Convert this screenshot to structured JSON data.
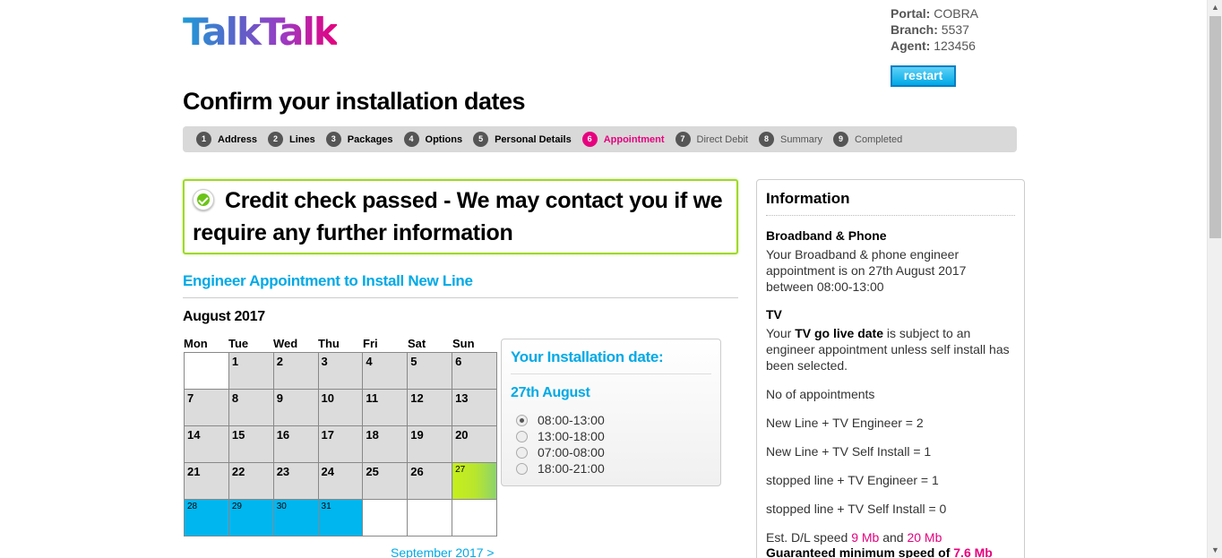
{
  "logo": {
    "text": "TalkTalk"
  },
  "portal": {
    "portal_label": "Portal:",
    "portal_value": "COBRA",
    "branch_label": "Branch:",
    "branch_value": "5537",
    "agent_label": "Agent:",
    "agent_value": "123456",
    "restart_label": "restart"
  },
  "page_title": "Confirm your installation dates",
  "steps": [
    {
      "num": "1",
      "label": "Address"
    },
    {
      "num": "2",
      "label": "Lines"
    },
    {
      "num": "3",
      "label": "Packages"
    },
    {
      "num": "4",
      "label": "Options"
    },
    {
      "num": "5",
      "label": "Personal Details"
    },
    {
      "num": "6",
      "label": "Appointment"
    },
    {
      "num": "7",
      "label": "Direct Debit"
    },
    {
      "num": "8",
      "label": "Summary"
    },
    {
      "num": "9",
      "label": "Completed"
    }
  ],
  "credit_message": "Credit check passed - We may contact you if we require any further information",
  "engineer_heading": "Engineer Appointment to Install New Line",
  "calendar": {
    "month": "August 2017",
    "days_of_week": [
      "Mon",
      "Tue",
      "Wed",
      "Thu",
      "Fri",
      "Sat",
      "Sun"
    ],
    "weeks": [
      [
        "",
        "1",
        "2",
        "3",
        "4",
        "5",
        "6"
      ],
      [
        "7",
        "8",
        "9",
        "10",
        "11",
        "12",
        "13"
      ],
      [
        "14",
        "15",
        "16",
        "17",
        "18",
        "19",
        "20"
      ],
      [
        "21",
        "22",
        "23",
        "24",
        "25",
        "26",
        "27"
      ],
      [
        "28",
        "29",
        "30",
        "31",
        "",
        "",
        ""
      ]
    ],
    "selected_day": "27",
    "available_days": [
      "28",
      "29",
      "30",
      "31"
    ],
    "next_month_link": "September 2017 >"
  },
  "install": {
    "title": "Your Installation date:",
    "date": "27th August",
    "slots": [
      "08:00-13:00",
      "13:00-18:00",
      "07:00-08:00",
      "18:00-21:00"
    ],
    "selected_slot": "08:00-13:00"
  },
  "info": {
    "title": "Information",
    "bb_heading": "Broadband & Phone",
    "bb_text": "Your Broadband & phone engineer appointment is on 27th August 2017 between 08:00-13:00",
    "tv_heading": "TV",
    "tv_text_pre": "Your ",
    "tv_text_bold": "TV go live date",
    "tv_text_post": " is subject to an engineer appointment unless self install has been selected.",
    "appointments_label": "No of appointments",
    "lines": [
      "New Line + TV Engineer = 2",
      "New Line + TV Self Install = 1",
      "stopped line + TV Engineer = 1",
      "stopped line + TV Self Install = 0"
    ],
    "speed_pre": "Est. D/L speed ",
    "speed_low": "9 Mb",
    "speed_and": " and ",
    "speed_high": "20 Mb",
    "guaranteed_pre": "Guaranteed minimum speed of ",
    "guaranteed_value": "7.6 Mb"
  },
  "colors": {
    "accent": "#00a9e6",
    "active_step": "#e6007e",
    "success_border": "#9fd828"
  }
}
